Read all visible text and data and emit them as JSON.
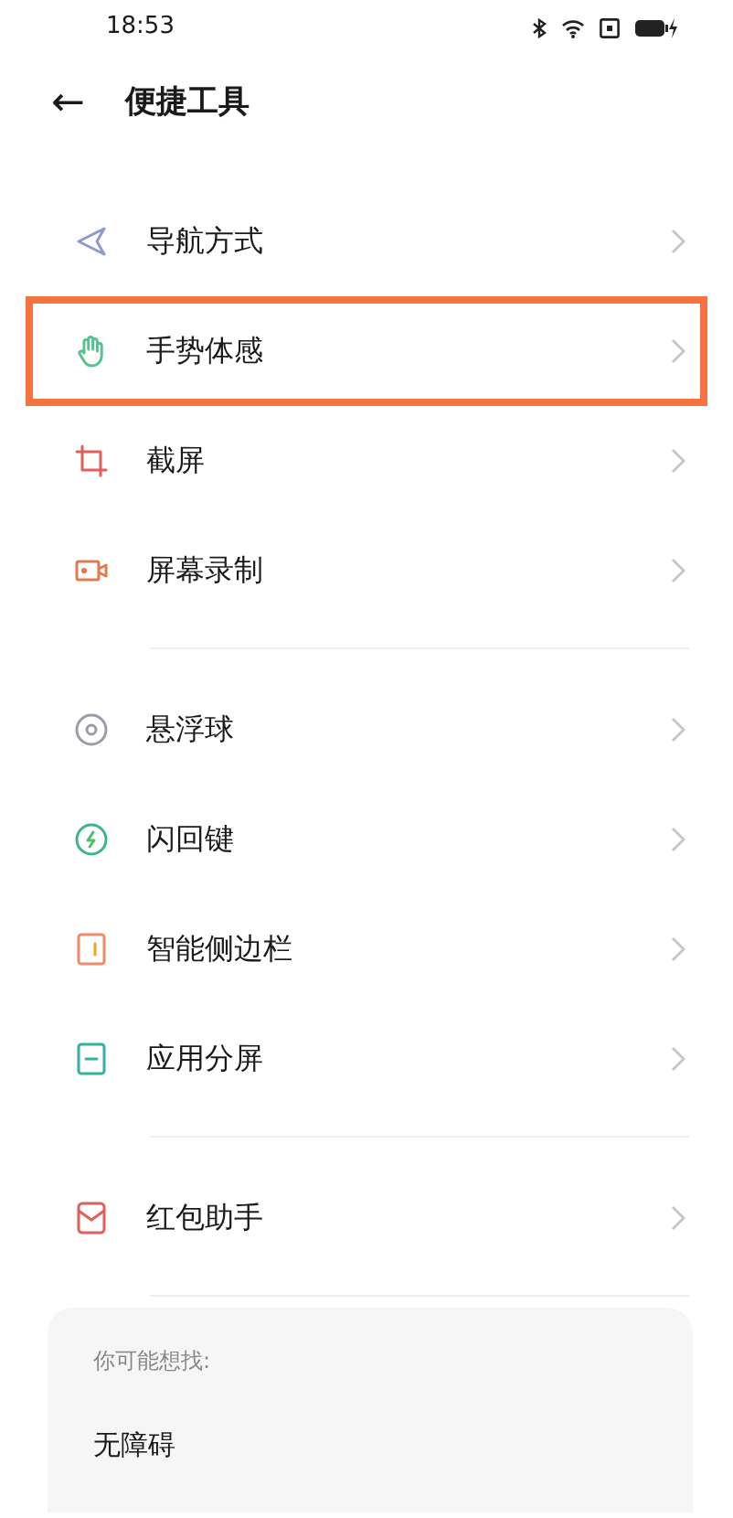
{
  "status_bar": {
    "time": "18:53"
  },
  "header": {
    "back": "←",
    "title": "便捷工具"
  },
  "groups": [
    {
      "items": [
        {
          "label": "导航方式",
          "kind": "navigation",
          "color": "#8e9bc9",
          "highlighted": false
        },
        {
          "label": "手势体感",
          "kind": "hand",
          "color": "#5bbf94",
          "highlighted": true
        },
        {
          "label": "截屏",
          "kind": "crop",
          "color": "#e0605a",
          "highlighted": false
        },
        {
          "label": "屏幕录制",
          "kind": "record",
          "color": "#e07a50",
          "highlighted": false
        }
      ]
    },
    {
      "items": [
        {
          "label": "悬浮球",
          "kind": "ball",
          "color": "#9a9ca8",
          "highlighted": false
        },
        {
          "label": "闪回键",
          "kind": "flash",
          "color": "#3cb58e",
          "highlighted": false
        },
        {
          "label": "智能侧边栏",
          "kind": "sidebar",
          "color": "#ef8a6a",
          "highlighted": false
        },
        {
          "label": "应用分屏",
          "kind": "split",
          "color": "#33b3a0",
          "highlighted": false
        }
      ]
    },
    {
      "items": [
        {
          "label": "红包助手",
          "kind": "envelope",
          "color": "#e0605a",
          "highlighted": false
        }
      ]
    }
  ],
  "suggestions": {
    "title": "你可能想找:",
    "items": [
      "无障碍"
    ]
  }
}
